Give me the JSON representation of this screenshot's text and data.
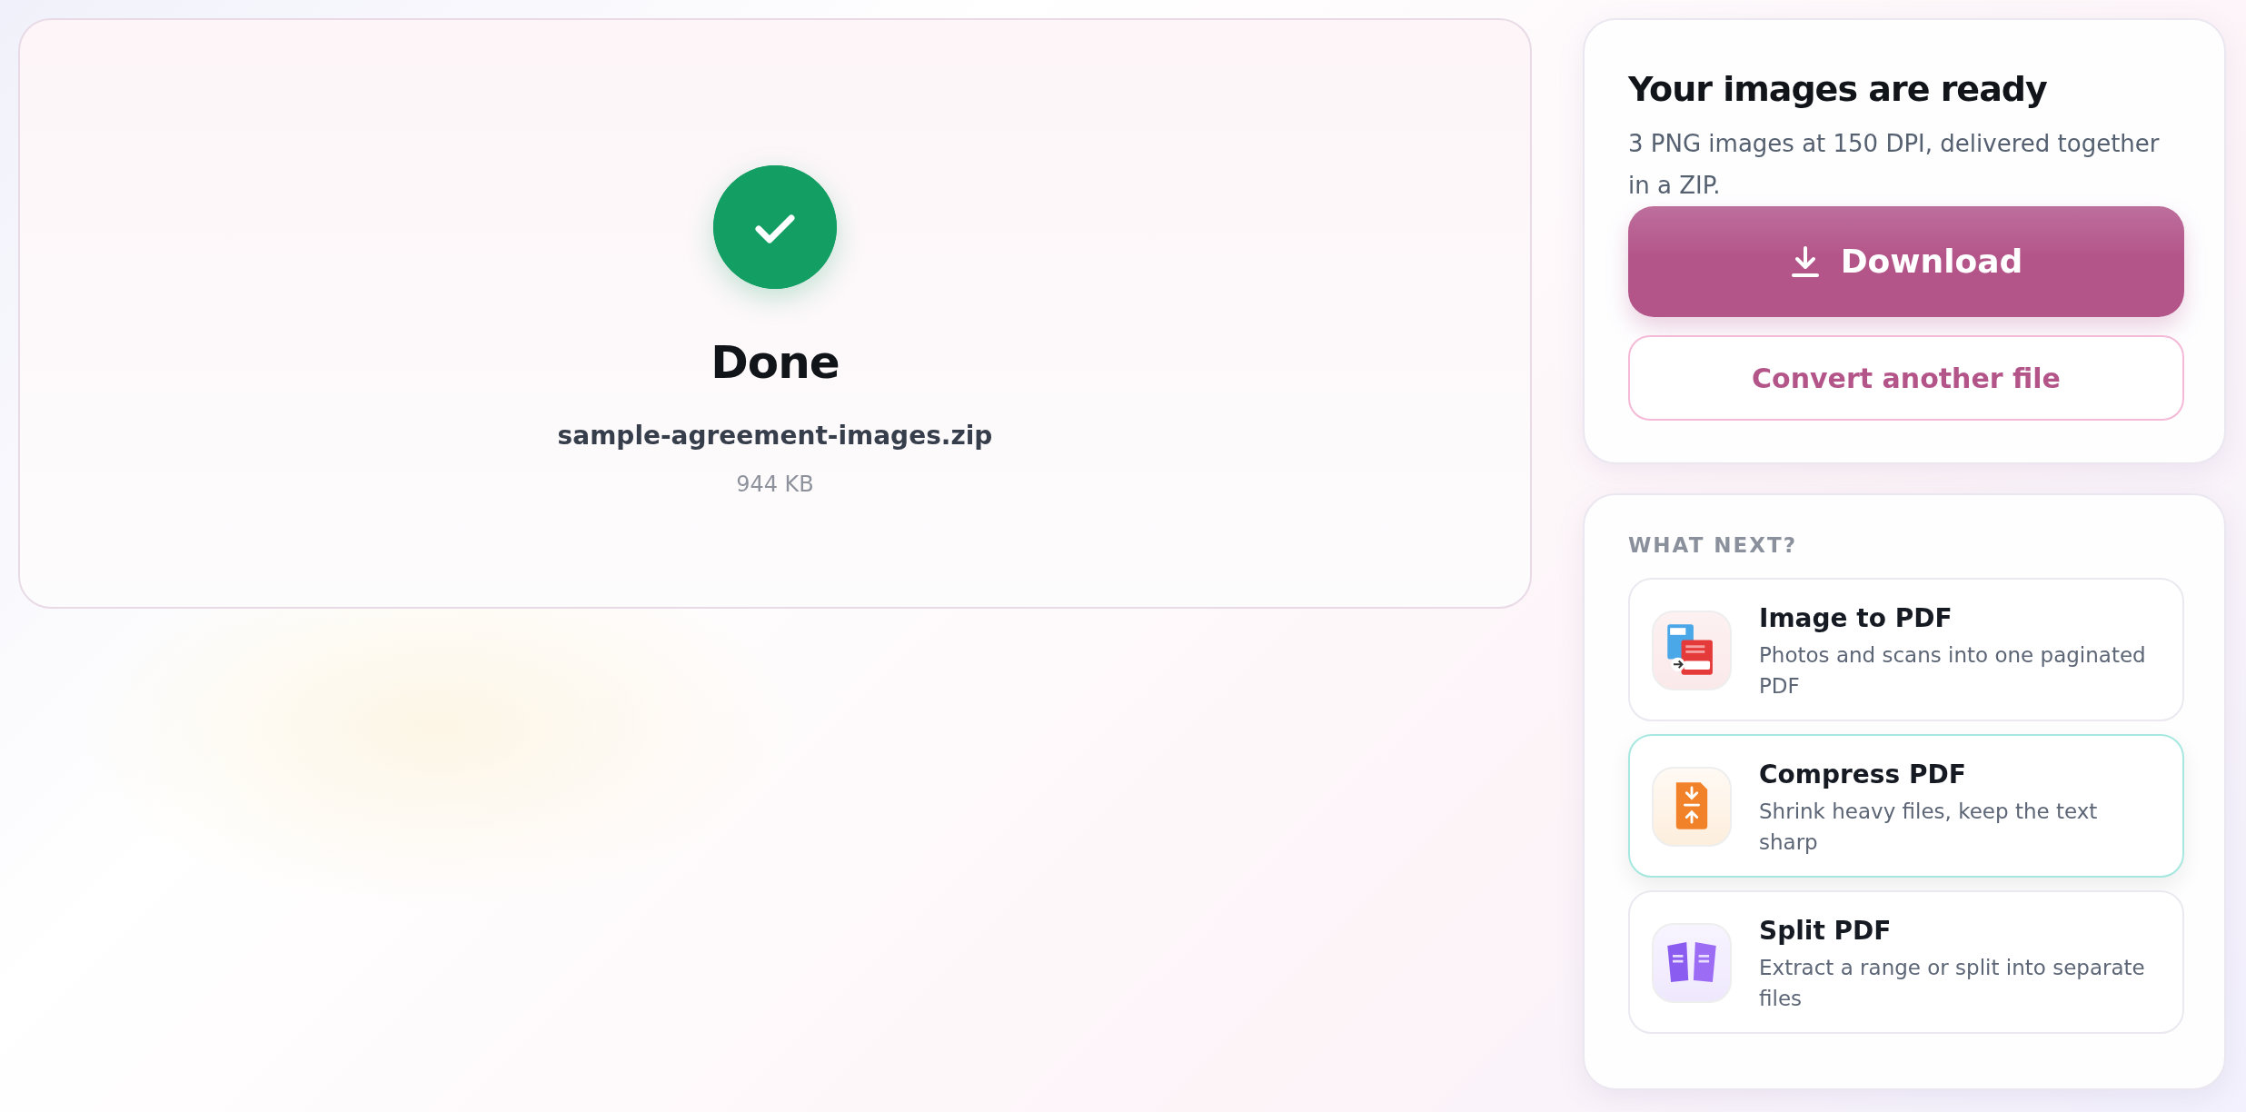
{
  "result": {
    "title": "Done",
    "file_name": "sample-agreement-images.zip",
    "file_size": "944 KB"
  },
  "ready_card": {
    "title": "Your images are ready",
    "description": "3 PNG images at 150 DPI, delivered together in a ZIP.",
    "download_button": "Download",
    "secondary_button": "Convert another file"
  },
  "what_next": {
    "heading": "WHAT NEXT?",
    "items": [
      {
        "kind": "image-to-pdf",
        "title": "Image to PDF",
        "description": "Photos and scans into one paginated PDF",
        "selected": false
      },
      {
        "kind": "compress",
        "title": "Compress PDF",
        "description": "Shrink heavy files, keep the text sharp",
        "selected": true
      },
      {
        "kind": "split",
        "title": "Split PDF",
        "description": "Extract a range or split into separate files",
        "selected": false
      }
    ]
  }
}
